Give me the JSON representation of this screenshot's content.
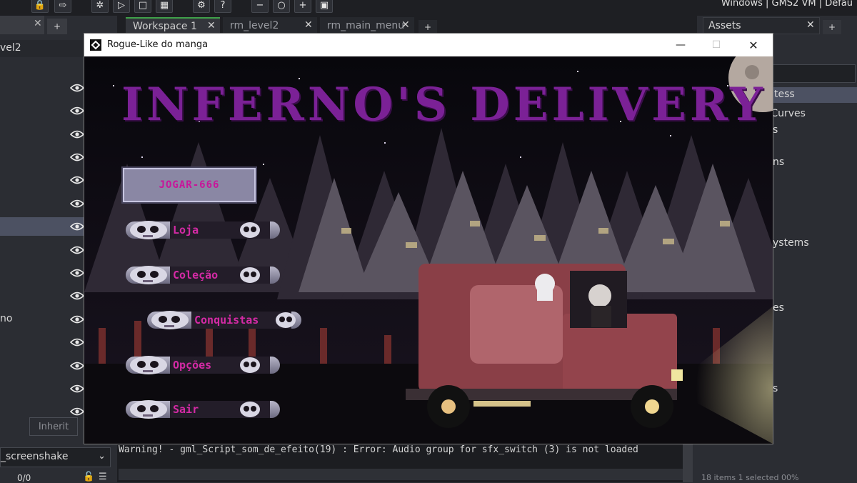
{
  "ide": {
    "target_text": "Windows  |  GMS2 VM  |  Defau",
    "workspace_tabs": [
      {
        "label": "Workspace 1"
      },
      {
        "label": "rm_level2"
      },
      {
        "label": "rm_main_menu"
      }
    ],
    "left_panel": {
      "room_name": "vel2",
      "partial_label": "no",
      "inherit_label": "Inherit",
      "dropdown_value": "_screenshake",
      "counter": "0/0"
    },
    "right_panel": {
      "assets_tab": "Assets",
      "items": [
        "tess",
        "n Curves",
        "s",
        "ns",
        "ystems",
        "es",
        "s"
      ],
      "status": "18 items   1 selected   00%"
    },
    "console": {
      "message": "Warning! - gml_Script_som_de_efeito(19) : Error: Audio group for sfx_switch (3) is not loaded"
    }
  },
  "game_window": {
    "title": "Rogue-Like do manga",
    "game_title": "INFERNO'S DELIVERY",
    "menu": {
      "play": "JOGAR-666",
      "items": [
        "Loja",
        "Coleção",
        "Conquistas",
        "Opções",
        "Sair"
      ]
    }
  },
  "colors": {
    "title_purple": "#7b2196",
    "menu_magenta": "#d42aa5",
    "ide_dark": "#2b2d33"
  }
}
